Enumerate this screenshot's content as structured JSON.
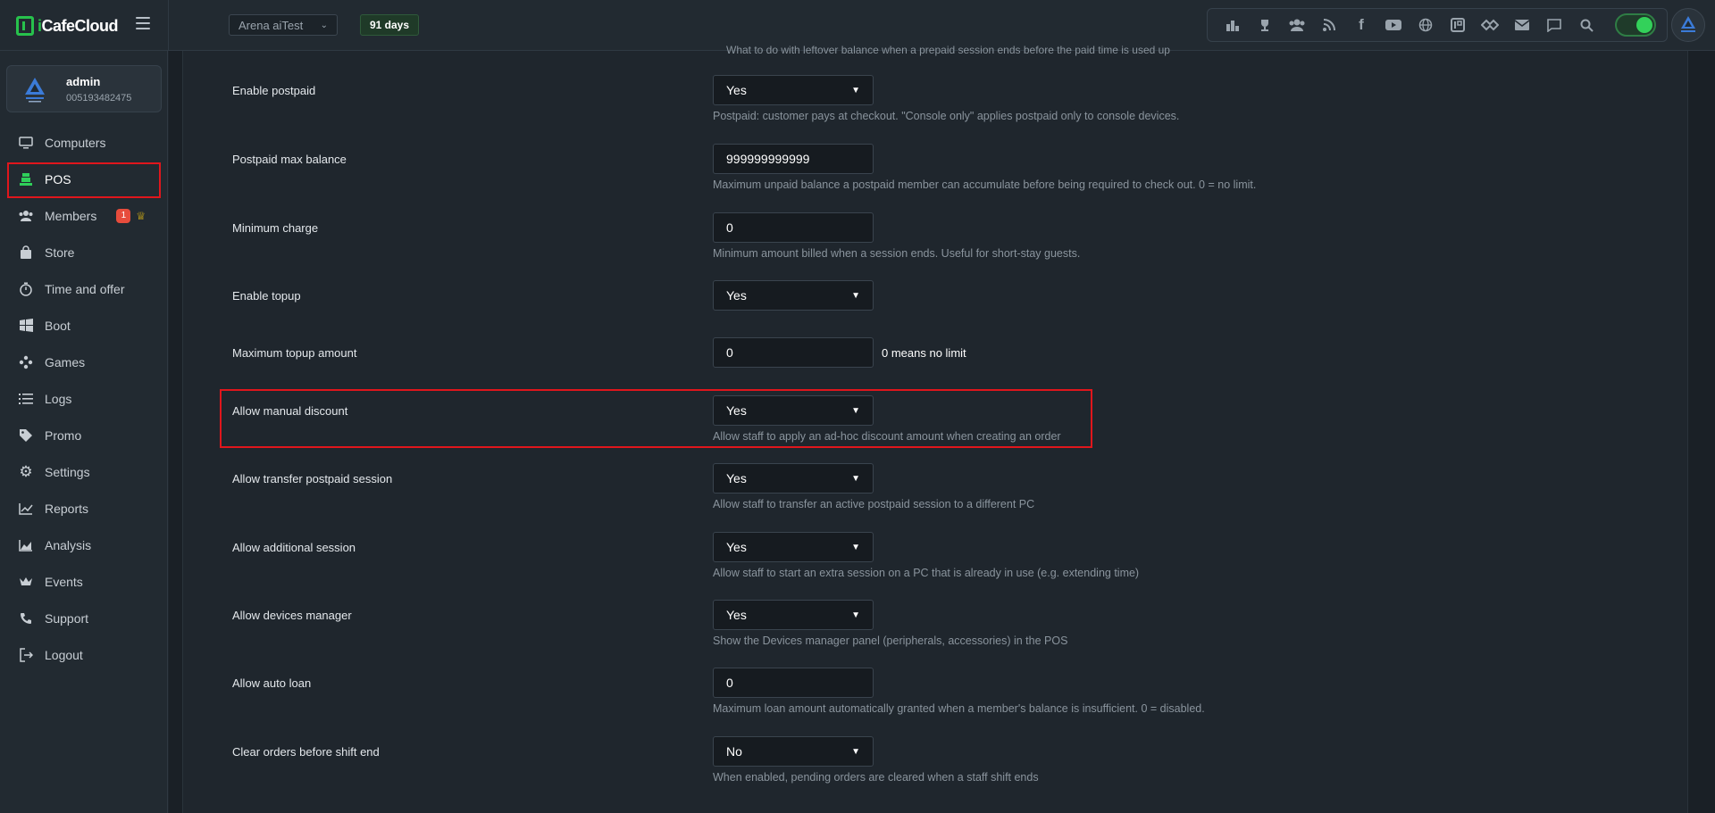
{
  "app": {
    "logo_prefix": "i",
    "logo_name": "CafeCloud",
    "center_name": "Arena aiTest",
    "days_badge": "91 days"
  },
  "user": {
    "name": "admin",
    "id": "005193482475"
  },
  "sidebar": {
    "items": [
      {
        "label": "Computers",
        "icon": "monitor-icon"
      },
      {
        "label": "POS",
        "icon": "cash-register-icon",
        "active": true
      },
      {
        "label": "Members",
        "icon": "users-icon",
        "badge": "1"
      },
      {
        "label": "Store",
        "icon": "shopping-bag-icon"
      },
      {
        "label": "Time and offer",
        "icon": "stopwatch-icon"
      },
      {
        "label": "Boot",
        "icon": "windows-icon"
      },
      {
        "label": "Games",
        "icon": "gamepad-icon"
      },
      {
        "label": "Logs",
        "icon": "list-icon"
      },
      {
        "label": "Promo",
        "icon": "tag-icon"
      },
      {
        "label": "Settings",
        "icon": "gear-icon"
      },
      {
        "label": "Reports",
        "icon": "line-chart-icon"
      },
      {
        "label": "Analysis",
        "icon": "area-chart-icon"
      },
      {
        "label": "Events",
        "icon": "crown-icon"
      },
      {
        "label": "Support",
        "icon": "phone-icon"
      },
      {
        "label": "Logout",
        "icon": "logout-icon"
      }
    ]
  },
  "toolbar_icons": [
    "podium-icon",
    "trophy-icon",
    "group-icon",
    "rss-icon",
    "facebook-icon",
    "youtube-icon",
    "globe-icon",
    "icafe-icon",
    "handshake-icon",
    "mail-icon",
    "chat-icon",
    "search-icon"
  ],
  "settings": {
    "top_cut_text": "What to do with leftover balance when a prepaid session ends before the paid time is used up",
    "rows": [
      {
        "label": "Enable postpaid",
        "type": "select",
        "value": "Yes",
        "help": "Postpaid: customer pays at checkout. \"Console only\" applies postpaid only to console devices."
      },
      {
        "label": "Postpaid max balance",
        "type": "input",
        "value": "999999999999",
        "help": "Maximum unpaid balance a postpaid member can accumulate before being required to check out. 0 = no limit."
      },
      {
        "label": "Minimum charge",
        "type": "input",
        "value": "0",
        "help": "Minimum amount billed when a session ends. Useful for short-stay guests."
      },
      {
        "label": "Enable topup",
        "type": "select",
        "value": "Yes",
        "help": ""
      },
      {
        "label": "Maximum topup amount",
        "type": "input",
        "value": "0",
        "help": "",
        "note": "0 means no limit"
      },
      {
        "label": "Allow manual discount",
        "type": "select",
        "value": "Yes",
        "help": "Allow staff to apply an ad-hoc discount amount when creating an order"
      },
      {
        "label": "Allow transfer postpaid session",
        "type": "select",
        "value": "Yes",
        "help": "Allow staff to transfer an active postpaid session to a different PC"
      },
      {
        "label": "Allow additional session",
        "type": "select",
        "value": "Yes",
        "help": "Allow staff to start an extra session on a PC that is already in use (e.g. extending time)"
      },
      {
        "label": "Allow devices manager",
        "type": "select",
        "value": "Yes",
        "help": "Show the Devices manager panel (peripherals, accessories) in the POS"
      },
      {
        "label": "Allow auto loan",
        "type": "input",
        "value": "0",
        "help": "Maximum loan amount automatically granted when a member's balance is insufficient. 0 = disabled."
      },
      {
        "label": "Clear orders before shift end",
        "type": "select",
        "value": "No",
        "help": "When enabled, pending orders are cleared when a staff shift ends"
      }
    ]
  },
  "colors": {
    "accent": "#27c24c",
    "highlight": "#e0161c",
    "badge": "#e74c3c"
  }
}
